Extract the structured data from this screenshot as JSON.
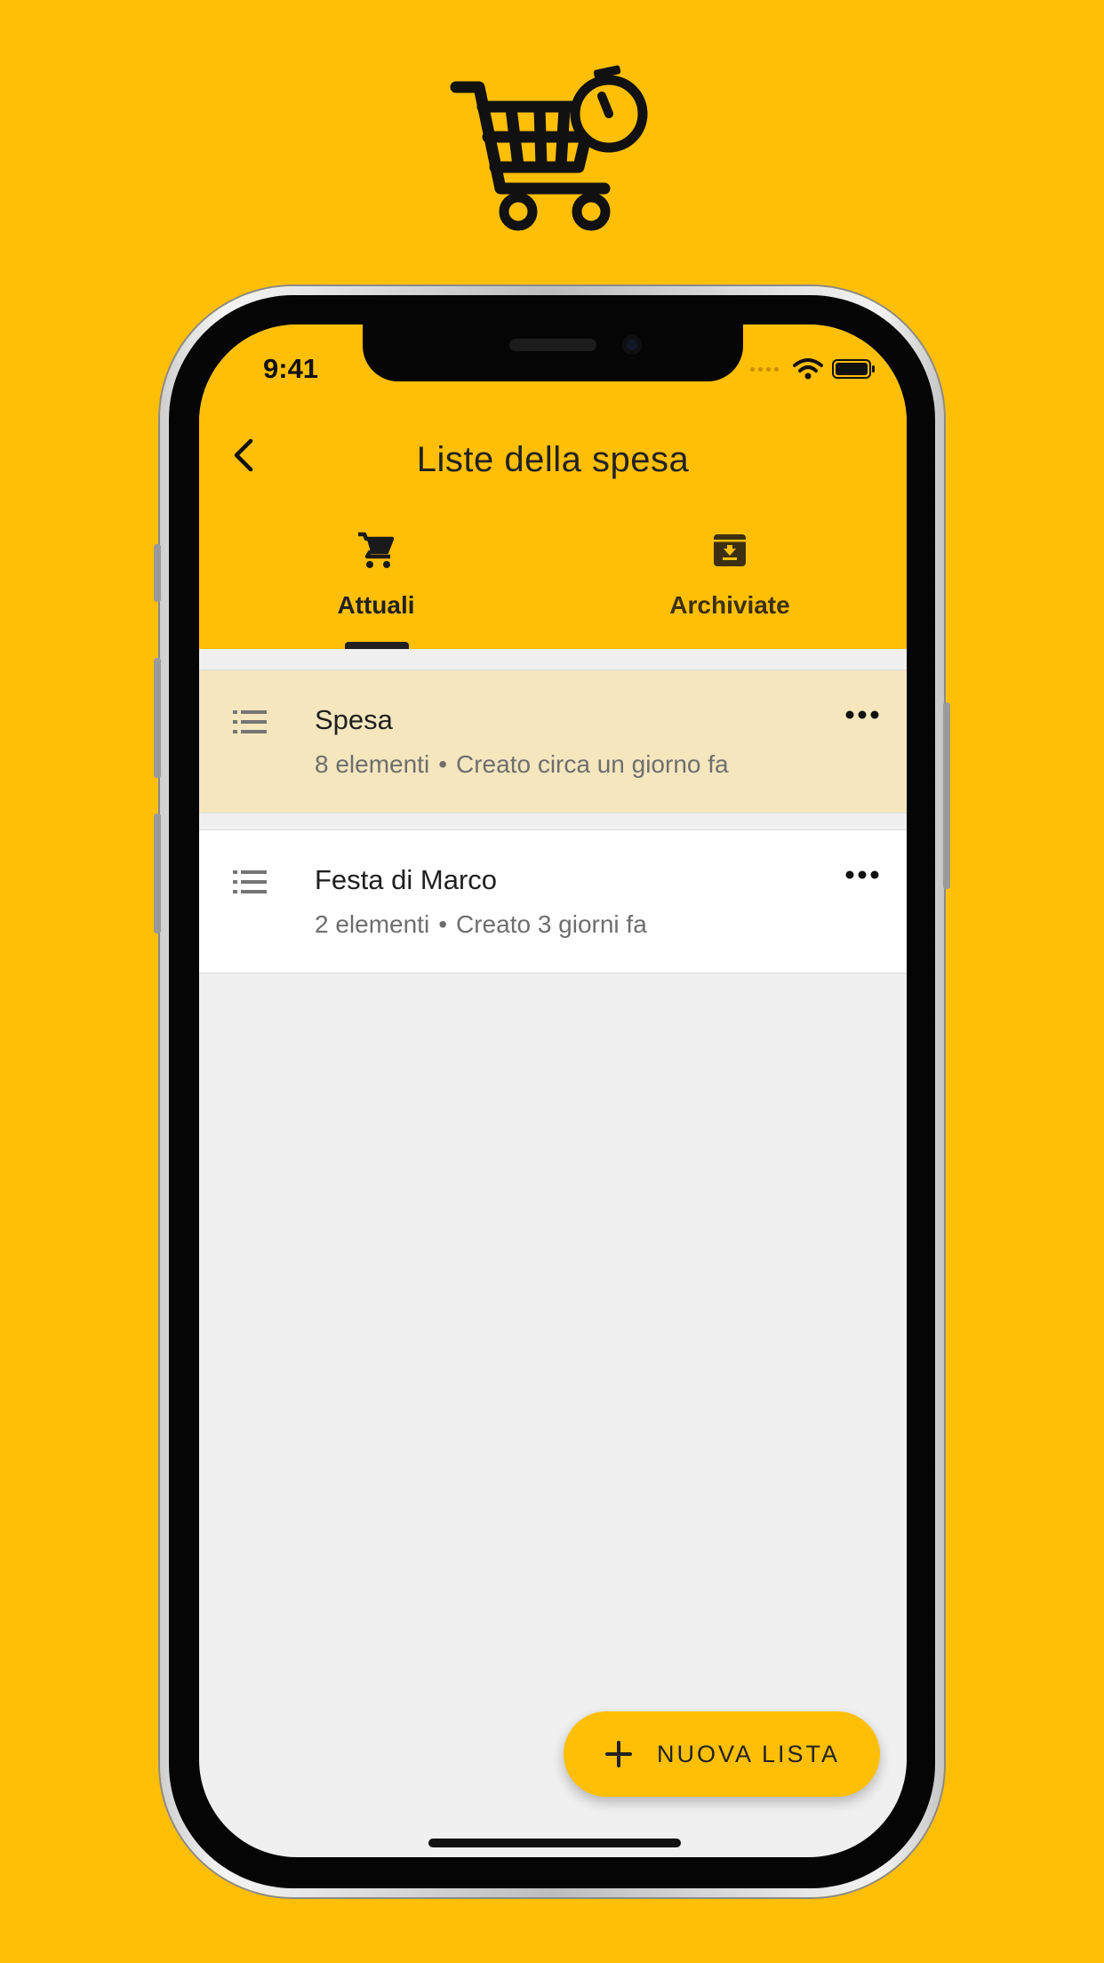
{
  "status_bar": {
    "time": "9:41"
  },
  "app_bar": {
    "title": "Liste della spesa"
  },
  "tabs": [
    {
      "label": "Attuali",
      "icon": "shopping-cart-icon",
      "selected": true
    },
    {
      "label": "Archiviate",
      "icon": "archive-icon",
      "selected": false
    }
  ],
  "lists": [
    {
      "title": "Spesa",
      "count": "8 elementi",
      "separator": "•",
      "created": "Creato circa un giorno fa",
      "highlighted": true
    },
    {
      "title": "Festa di Marco",
      "count": "2 elementi",
      "separator": "•",
      "created": "Creato 3 giorni fa",
      "highlighted": false
    }
  ],
  "fab": {
    "label": "NUOVA LISTA",
    "icon": "plus-icon"
  },
  "colors": {
    "accent": "#FFBF06",
    "highlight_row": "#F5E6BE",
    "background": "#F0F0F0"
  }
}
